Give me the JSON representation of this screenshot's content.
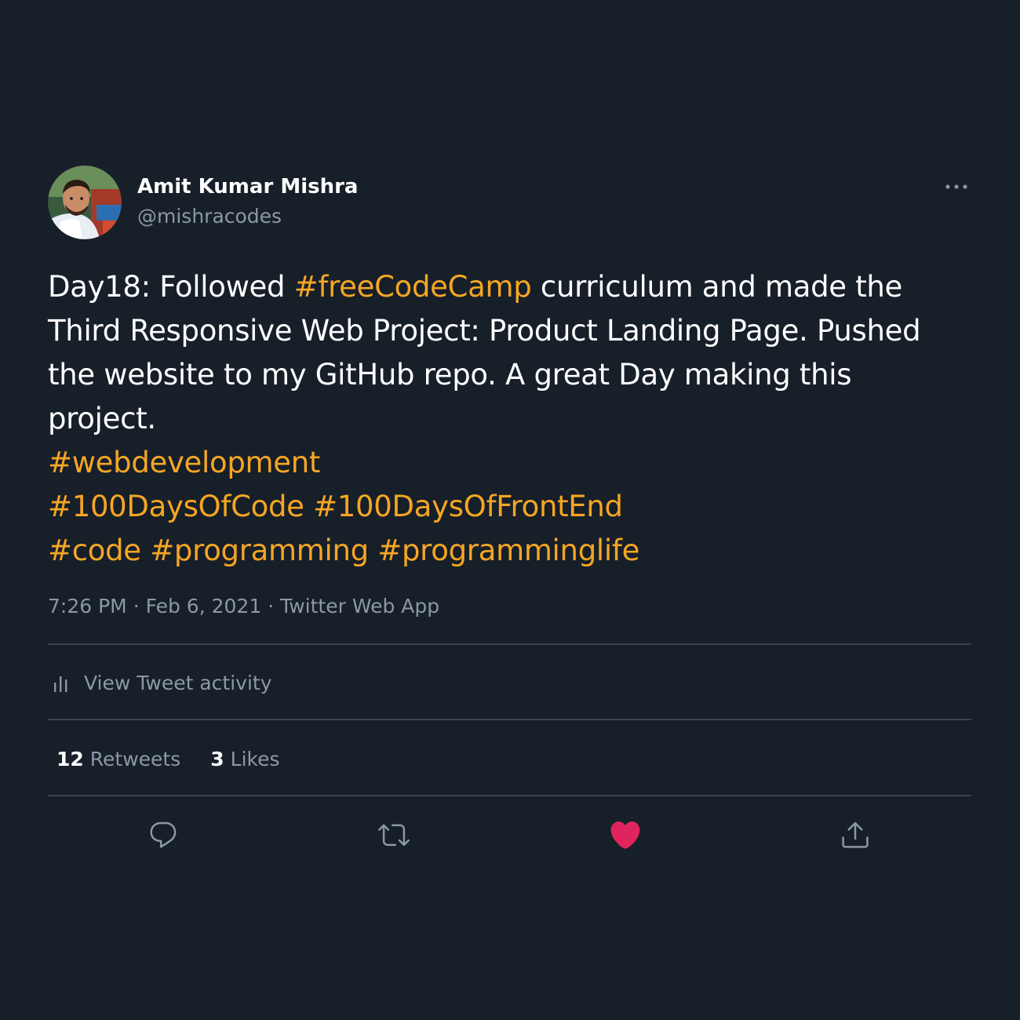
{
  "author": {
    "name": "Amit Kumar Mishra",
    "handle": "@mishracodes"
  },
  "tweet": {
    "lines": [
      [
        {
          "text": "Day18: Followed ",
          "hashtag": false
        },
        {
          "text": "#freeCodeCamp",
          "hashtag": true
        },
        {
          "text": " curriculum and made the",
          "hashtag": false
        }
      ],
      [
        {
          "text": "Third Responsive Web Project: Product Landing Page. Pushed",
          "hashtag": false
        }
      ],
      [
        {
          "text": "the website to my GitHub repo. A great Day making this",
          "hashtag": false
        }
      ],
      [
        {
          "text": "project.",
          "hashtag": false
        }
      ],
      [
        {
          "text": "#webdevelopment",
          "hashtag": true
        }
      ],
      [
        {
          "text": "#100DaysOfCode",
          "hashtag": true
        },
        {
          "text": " ",
          "hashtag": false
        },
        {
          "text": "#100DaysOfFrontEnd",
          "hashtag": true
        }
      ],
      [
        {
          "text": "#code",
          "hashtag": true
        },
        {
          "text": " ",
          "hashtag": false
        },
        {
          "text": "#programming",
          "hashtag": true
        },
        {
          "text": " ",
          "hashtag": false
        },
        {
          "text": "#programminglife",
          "hashtag": true
        }
      ]
    ]
  },
  "meta": {
    "time": "7:26 PM",
    "separator": "·",
    "date": "Feb 6, 2021",
    "source": "Twitter Web App"
  },
  "activity": {
    "label": "View Tweet activity"
  },
  "stats": {
    "retweets_count": "12",
    "retweets_label": "Retweets",
    "likes_count": "3",
    "likes_label": "Likes"
  },
  "actions": {
    "icons": [
      "reply-icon",
      "retweet-icon",
      "like-icon",
      "share-icon"
    ],
    "liked": true
  },
  "colors": {
    "background": "#171f29",
    "hashtag": "#f5a623",
    "secondary_text": "#8b98a5",
    "primary_text": "#ffffff",
    "divider": "#38444d",
    "like": "#e0245e"
  }
}
